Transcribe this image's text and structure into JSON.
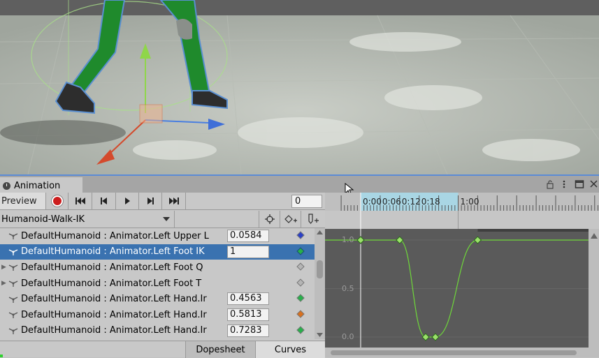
{
  "window": {
    "tab_title": "Animation",
    "icons": [
      "clock-icon",
      "lock-icon",
      "more-icon",
      "maximize-icon",
      "close-icon"
    ]
  },
  "toolbar": {
    "preview_label": "Preview",
    "frame_value": "0",
    "controls": [
      "record-icon",
      "first-key-icon",
      "prev-key-icon",
      "play-icon",
      "next-key-icon",
      "last-key-icon"
    ]
  },
  "clip": {
    "name": "Humanoid-Walk-IK"
  },
  "properties": [
    {
      "label": "DefaultHumanoid : Animator.Left Upper L",
      "value": "0.0584",
      "expandable": false,
      "selected": false,
      "key_color": "#2a3fc8"
    },
    {
      "label": "DefaultHumanoid : Animator.Left Foot IK",
      "value": "1",
      "expandable": false,
      "selected": true,
      "key_color": "#27b04a"
    },
    {
      "label": "DefaultHumanoid : Animator.Left Foot Q",
      "value": "",
      "expandable": true,
      "selected": false,
      "key_color": "#b5b5b5"
    },
    {
      "label": "DefaultHumanoid : Animator.Left Foot T",
      "value": "",
      "expandable": true,
      "selected": false,
      "key_color": "#b5b5b5"
    },
    {
      "label": "DefaultHumanoid : Animator.Left Hand.Ir",
      "value": "0.4563",
      "expandable": false,
      "selected": false,
      "key_color": "#27b04a"
    },
    {
      "label": "DefaultHumanoid : Animator.Left Hand.Ir",
      "value": "0.5813",
      "expandable": false,
      "selected": false,
      "key_color": "#d9701e"
    },
    {
      "label": "DefaultHumanoid : Animator.Left Hand.Ir",
      "value": "0.7283",
      "expandable": false,
      "selected": false,
      "key_color": "#27b04a"
    }
  ],
  "bottom_tabs": {
    "dopesheet": "Dopesheet",
    "curves": "Curves"
  },
  "timeline": {
    "ticks": [
      "0:00",
      "0:06",
      "0:12",
      "0:18",
      "1:00"
    ],
    "y_labels": [
      "1.0",
      "0.5",
      "0.0"
    ]
  },
  "chart_data": {
    "type": "line",
    "title": "",
    "xlabel": "",
    "ylabel": "",
    "x_ticks": [
      "0:00",
      "0:06",
      "0:12",
      "0:18",
      "1:00"
    ],
    "ylim": [
      0,
      1
    ],
    "series": [
      {
        "color": "#6fd83a",
        "keyframes": [
          {
            "x": "0:00",
            "y": 1.0
          },
          {
            "x": "0:12",
            "y": 1.0
          },
          {
            "x": "0:20",
            "y": 0.0
          },
          {
            "x": "0:23",
            "y": 0.0
          },
          {
            "x": "1:06",
            "y": 1.0
          }
        ]
      }
    ]
  }
}
